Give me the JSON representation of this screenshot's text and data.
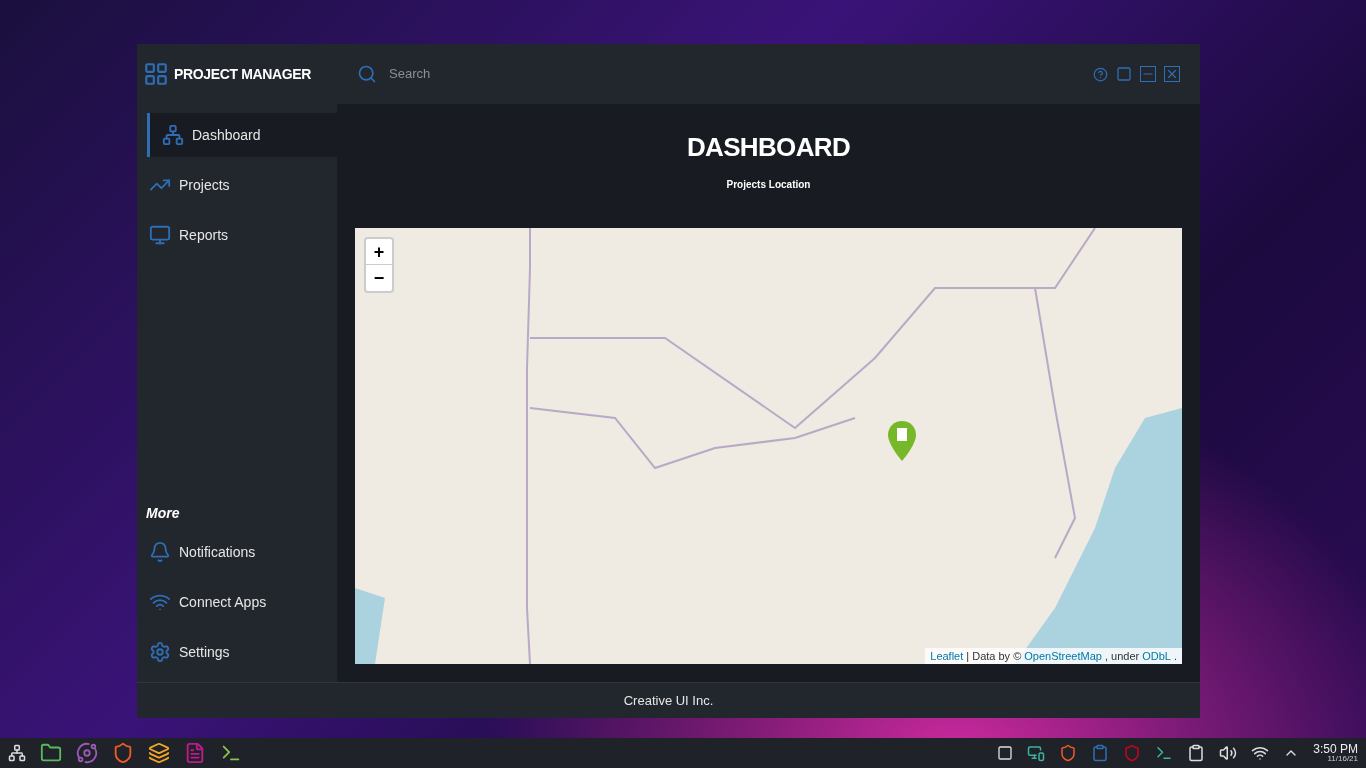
{
  "app": {
    "title": "PROJECT MANAGER"
  },
  "search": {
    "placeholder": "Search"
  },
  "nav": [
    {
      "label": "Dashboard",
      "selected": true
    },
    {
      "label": "Projects",
      "selected": false
    },
    {
      "label": "Reports",
      "selected": false
    }
  ],
  "more": {
    "heading": "More",
    "items": [
      {
        "label": "Notifications",
        "selected": false
      },
      {
        "label": "Connect Apps",
        "selected": false
      },
      {
        "label": "Settings",
        "selected": false
      }
    ]
  },
  "page": {
    "title": "DASHBOARD",
    "subtitle": "Projects Location"
  },
  "map": {
    "zoom_in": "+",
    "zoom_out": "−",
    "attribution": [
      {
        "text": "Leaflet",
        "kind": "link"
      },
      {
        "text": "| Data by ©",
        "kind": "text"
      },
      {
        "text": "OpenStreetMap",
        "kind": "link"
      },
      {
        "text": ", under",
        "kind": "text"
      },
      {
        "text": "ODbL",
        "kind": "link"
      },
      {
        "text": ".",
        "kind": "text"
      }
    ]
  },
  "footer": "Creative UI Inc.",
  "taskbar": {
    "time": "3:50 PM",
    "date": "11/16/21"
  }
}
